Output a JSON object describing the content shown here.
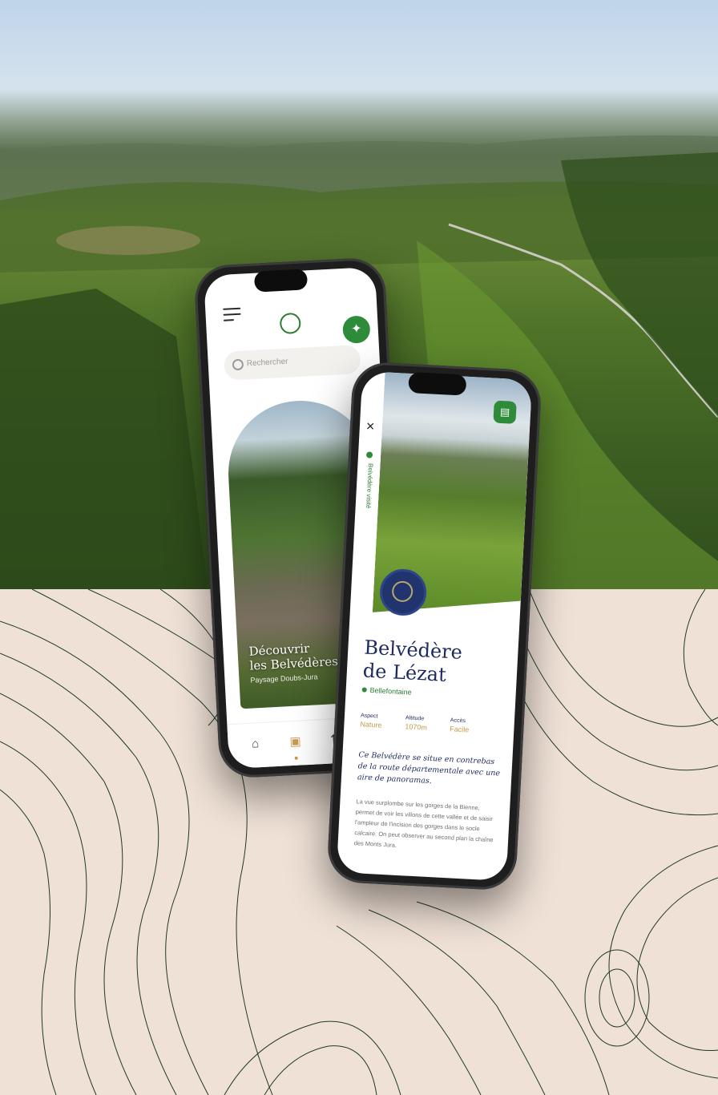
{
  "back_phone": {
    "search_placeholder": "Rechercher",
    "card": {
      "title_line1": "Découvrir",
      "title_line2": "les Belvédères",
      "subtitle": "Paysage Doubs-Jura"
    },
    "tabs": [
      {
        "name": "home-icon",
        "glyph": "⌂"
      },
      {
        "name": "book-icon",
        "glyph": "▣"
      },
      {
        "name": "transfer-icon",
        "glyph": "⇅"
      }
    ]
  },
  "front_phone": {
    "close": "×",
    "vertical_label": "Belvédère visité",
    "title_line1": "Belvédère",
    "title_line2": "de Lézat",
    "place": "Bellefontaine",
    "stats": [
      {
        "label": "Aspect",
        "value": "Nature"
      },
      {
        "label": "Altitude",
        "value": "1070m"
      },
      {
        "label": "Accès",
        "value": "Facile"
      }
    ],
    "lead": "Ce Belvédère se situe en contrebas de la route départementale avec une aire de panoramas.",
    "body": "La vue surplombe sur les gorges de la Bienne, permet de voir les villons de cette vallée et de saisir l'ampleur de l'incision des gorges dans le socle calcaire. On peut observer au second plan la chaîne des Monts Jura."
  },
  "colors": {
    "accent_green": "#2e8b3a",
    "navy": "#1c2a5e",
    "gold": "#c79a4f",
    "paper": "#efe1d6"
  }
}
